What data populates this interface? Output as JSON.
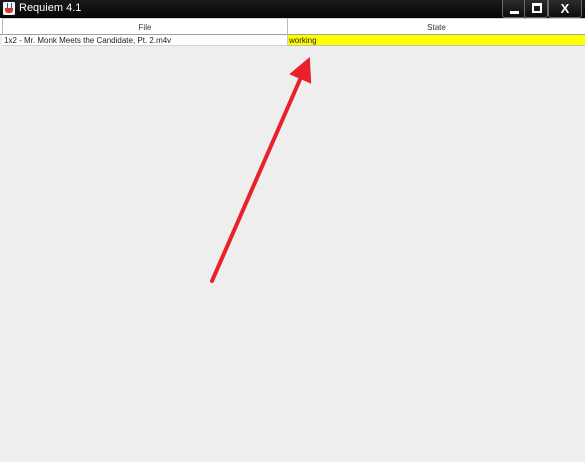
{
  "window": {
    "title": "Requiem 4.1",
    "controls": {
      "minimize_icon": "minimize-icon",
      "maximize_icon": "maximize-icon",
      "close_icon": "close-icon",
      "close_glyph": "X"
    }
  },
  "table": {
    "columns": [
      "File",
      "State"
    ],
    "rows": [
      {
        "file": "1x2 - Mr. Monk Meets the Candidate, Pt. 2.m4v",
        "state": "working",
        "state_color": "#ffff00"
      }
    ]
  },
  "annotation": {
    "type": "arrow",
    "color": "#e8222a",
    "points_to": "state-cell"
  }
}
